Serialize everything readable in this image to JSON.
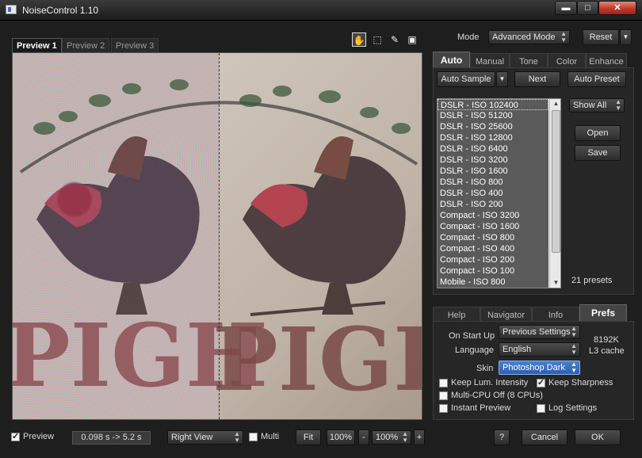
{
  "window": {
    "title": "NoiseControl 1.10",
    "controls": {
      "minimize": "▬",
      "maximize": "□",
      "close": "✕"
    }
  },
  "preview": {
    "tabs": [
      "Preview 1",
      "Preview 2",
      "Preview 3"
    ],
    "active_tab": 0,
    "tools": [
      {
        "name": "hand-tool",
        "glyph": "✋"
      },
      {
        "name": "marquee-tool",
        "glyph": "⬚"
      },
      {
        "name": "eyedropper-tool",
        "glyph": "✎"
      },
      {
        "name": "frame-tool",
        "glyph": "▣"
      }
    ],
    "image_text": "PIGH"
  },
  "top_right": {
    "mode_label": "Mode",
    "mode_value": "Advanced Mode",
    "reset_label": "Reset"
  },
  "main_tabs": [
    "Auto",
    "Manual",
    "Tone",
    "Color",
    "Enhance"
  ],
  "active_main_tab": 0,
  "auto": {
    "auto_sample_label": "Auto Sample",
    "next_label": "Next",
    "auto_preset_label": "Auto Preset",
    "presets": [
      "DSLR - ISO 102400",
      "DSLR - ISO 51200",
      "DSLR - ISO 25600",
      "DSLR - ISO 12800",
      "DSLR - ISO 6400",
      "DSLR - ISO 3200",
      "DSLR - ISO 1600",
      "DSLR - ISO 800",
      "DSLR - ISO 400",
      "DSLR - ISO 200",
      "Compact - ISO 3200",
      "Compact - ISO 1600",
      "Compact - ISO 800",
      "Compact - ISO 400",
      "Compact - ISO 200",
      "Compact - ISO 100",
      "Mobile - ISO 800"
    ],
    "filter_value": "Show All",
    "open_label": "Open",
    "save_label": "Save",
    "preset_count": "21 presets"
  },
  "bottom_tabs": [
    "Help",
    "Navigator",
    "Info",
    "Prefs"
  ],
  "active_bottom_tab": 3,
  "prefs": {
    "on_start_up_label": "On Start Up",
    "on_start_up_value": "Previous Settings",
    "language_label": "Language",
    "language_value": "English",
    "skin_label": "Skin",
    "skin_value": "Photoshop Dark",
    "cache_size": "8192K",
    "cache_label": "L3 cache",
    "options": [
      {
        "label": "Keep Lum. Intensity",
        "checked": false
      },
      {
        "label": "Keep Sharpness",
        "checked": true
      },
      {
        "label": "Multi-CPU Off (8 CPUs)",
        "checked": false
      },
      {
        "label": "Instant Preview",
        "checked": false
      },
      {
        "label": "Log Settings",
        "checked": false
      }
    ]
  },
  "bottom_bar": {
    "preview_label": "Preview",
    "preview_checked": true,
    "timing": "0.098 s -> 5.2 s",
    "view_value": "Right View",
    "multi_label": "Multi",
    "multi_checked": false,
    "fit_label": "Fit",
    "zoom_a": "100%",
    "minus_label": "-",
    "zoom_b": "100%",
    "plus_label": "+",
    "help_label": "?",
    "cancel_label": "Cancel",
    "ok_label": "OK"
  }
}
